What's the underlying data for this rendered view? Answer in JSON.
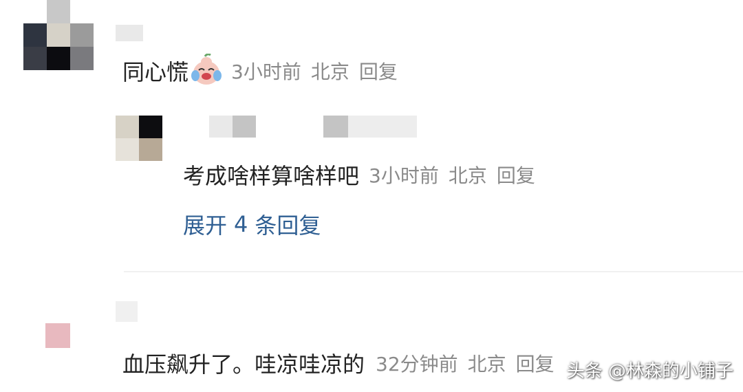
{
  "comments": [
    {
      "text": "同心慌",
      "emoji": "laughing-crying-face-icon",
      "time": "3小时前",
      "location": "北京",
      "reply_label": "回复",
      "replies": [
        {
          "text": "考成啥样算啥样吧",
          "time": "3小时前",
          "location": "北京",
          "reply_label": "回复"
        }
      ],
      "expand": {
        "prefix": "展开",
        "count": "4",
        "suffix": "条回复"
      }
    },
    {
      "text": "血压飙升了。哇凉哇凉的",
      "time": "32分钟前",
      "location": "北京",
      "reply_label": "回复"
    }
  ],
  "watermark": "头条 @林森的小铺子",
  "colors": {
    "text": "#222222",
    "meta": "#8a8a8a",
    "link": "#2f5f93"
  }
}
